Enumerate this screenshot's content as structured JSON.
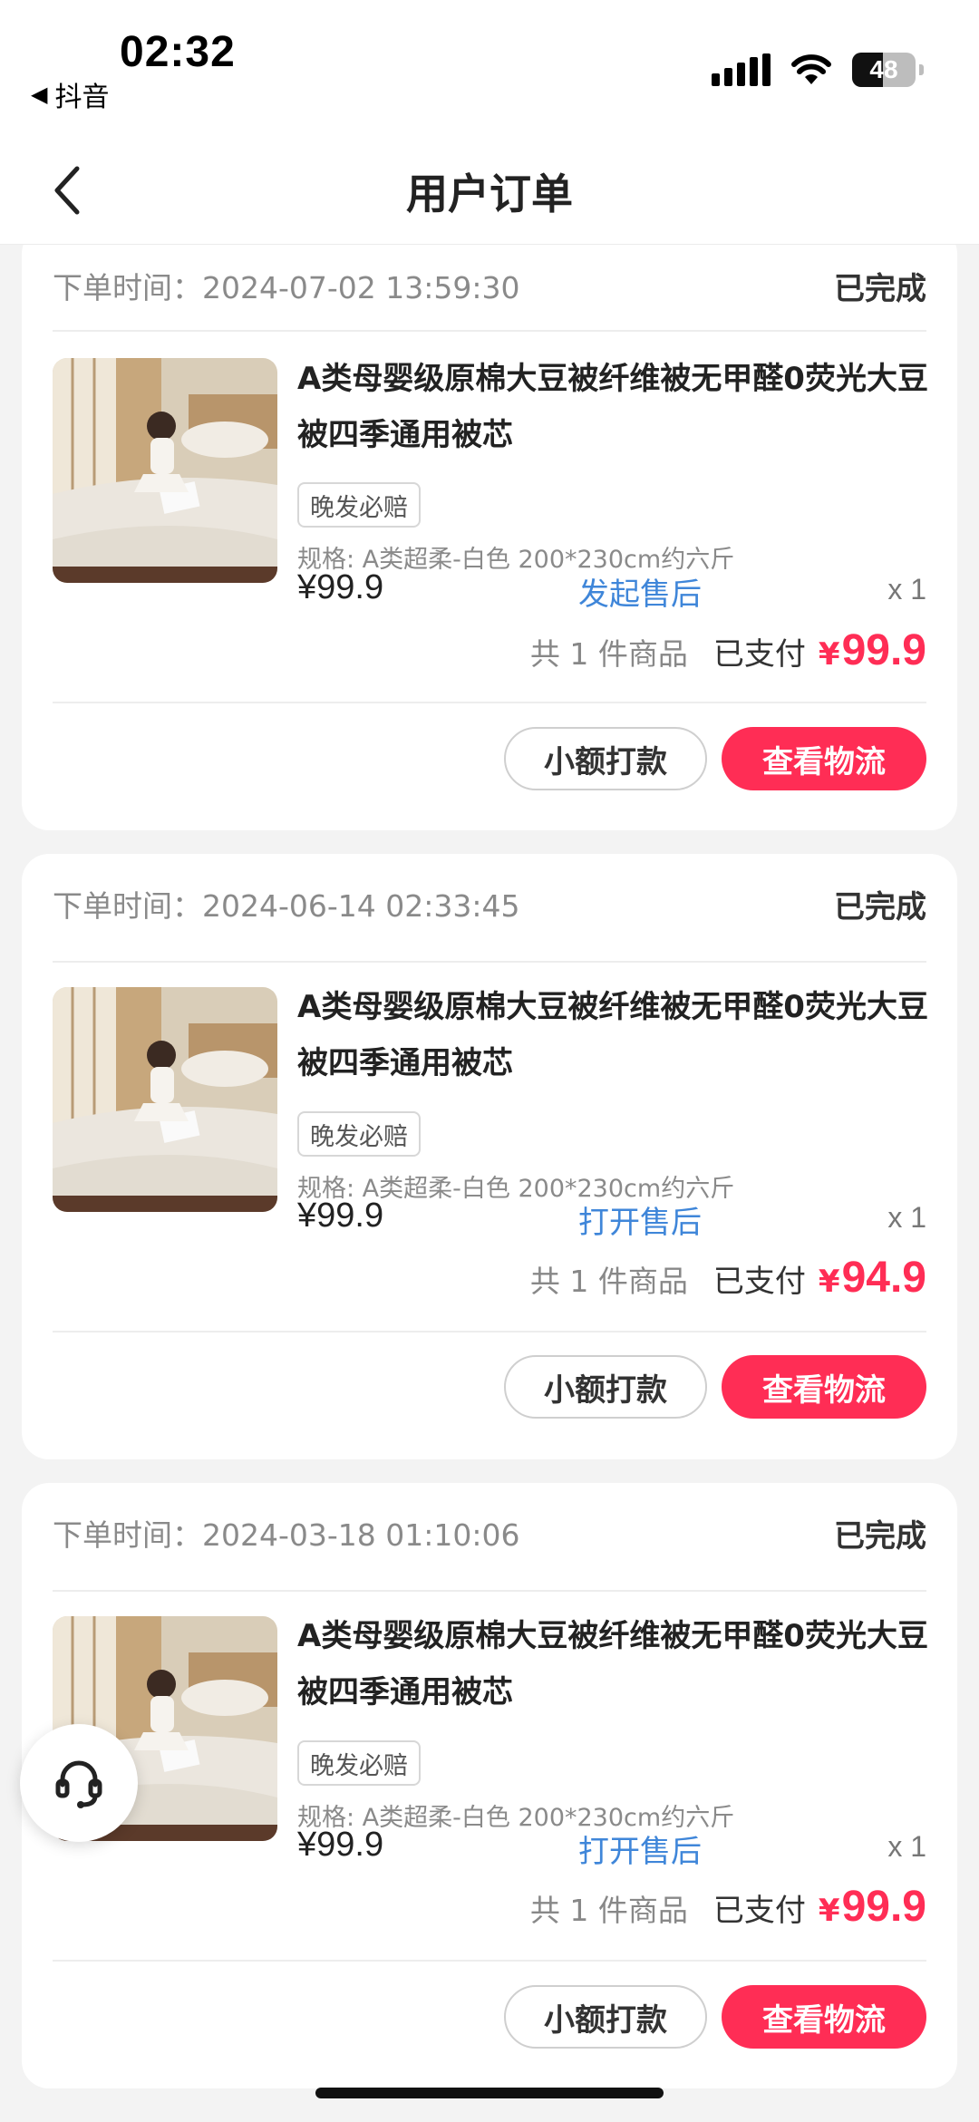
{
  "status_bar": {
    "time": "02:32",
    "back_app": "抖音",
    "battery": "48"
  },
  "header": {
    "title": "用户订单"
  },
  "orders": [
    {
      "time_label": "下单时间：",
      "time": "2024-07-02 13:59:30",
      "status": "已完成",
      "product_title": "A类母婴级原棉大豆被纤维被无甲醛0荧光大豆被四季通用被芯",
      "badge": "晚发必赔",
      "spec": "规格: A类超柔-白色 200*230cm约六斤",
      "price": "¥99.9",
      "after_sale": "发起售后",
      "qty": "x 1",
      "count": "共 1 件商品",
      "paid_label": "已支付",
      "paid_currency": "¥",
      "paid_amount": "99.9",
      "btn_small_pay": "小额打款",
      "btn_logistics": "查看物流"
    },
    {
      "time_label": "下单时间：",
      "time": "2024-06-14 02:33:45",
      "status": "已完成",
      "product_title": "A类母婴级原棉大豆被纤维被无甲醛0荧光大豆被四季通用被芯",
      "badge": "晚发必赔",
      "spec": "规格: A类超柔-白色 200*230cm约六斤",
      "price": "¥99.9",
      "after_sale": "打开售后",
      "qty": "x 1",
      "count": "共 1 件商品",
      "paid_label": "已支付",
      "paid_currency": "¥",
      "paid_amount": "94.9",
      "btn_small_pay": "小额打款",
      "btn_logistics": "查看物流"
    },
    {
      "time_label": "下单时间：",
      "time": "2024-03-18 01:10:06",
      "status": "已完成",
      "product_title": "A类母婴级原棉大豆被纤维被无甲醛0荧光大豆被四季通用被芯",
      "badge": "晚发必赔",
      "spec": "规格: A类超柔-白色 200*230cm约六斤",
      "price": "¥99.9",
      "after_sale": "打开售后",
      "qty": "x 1",
      "count": "共 1 件商品",
      "paid_label": "已支付",
      "paid_currency": "¥",
      "paid_amount": "99.9",
      "btn_small_pay": "小额打款",
      "btn_logistics": "查看物流"
    }
  ],
  "colors": {
    "accent_red": "#ff2d55",
    "link_blue": "#3f86d9",
    "background": "#f3f3f3"
  },
  "icons": [
    "back-chevron-icon",
    "signal-icon",
    "wifi-icon",
    "battery-icon",
    "customer-service-icon"
  ]
}
